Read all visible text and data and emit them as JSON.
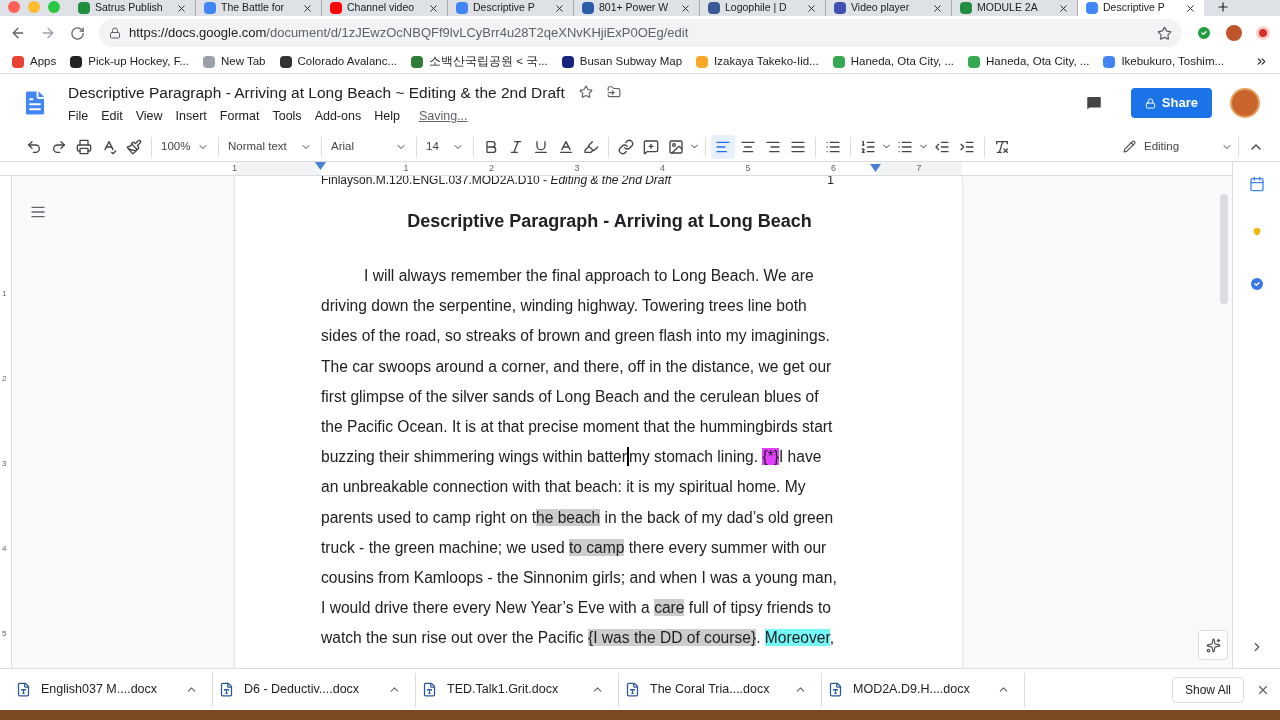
{
  "browser": {
    "tabs": [
      {
        "title": "Satrus Publish",
        "color": "#1e8e3e",
        "selected": false
      },
      {
        "title": "The Battle for",
        "color": "#4285f4",
        "selected": false
      },
      {
        "title": "Channel video",
        "color": "#ff0000",
        "selected": false
      },
      {
        "title": "Descriptive P",
        "color": "#4285f4",
        "selected": false
      },
      {
        "title": "801+ Power W",
        "color": "#2a5caa",
        "selected": false
      },
      {
        "title": "Logophile | D",
        "color": "#3b5998",
        "selected": false
      },
      {
        "title": "Video player",
        "color": "#3f51b5",
        "selected": false
      },
      {
        "title": "MODULE 2A",
        "color": "#1e8e3e",
        "selected": false
      },
      {
        "title": "Descriptive P",
        "color": "#4285f4",
        "selected": true
      }
    ],
    "url_host": "https://docs.google.com",
    "url_path": "/document/d/1zJEwzOcNBQFf9lvLCyBrr4u28T2qeXNvKHjiExP0OEg/edit",
    "bookmarks": [
      {
        "label": "Apps",
        "color": "#e94235"
      },
      {
        "label": "Pick-up Hockey, F...",
        "color": "#222222"
      },
      {
        "label": "New Tab",
        "color": "#9aa0a6"
      },
      {
        "label": "Colorado Avalanc...",
        "color": "#333333"
      },
      {
        "label": "소백산국립공원 < 국...",
        "color": "#2e7d32"
      },
      {
        "label": "Busan Subway Map",
        "color": "#1a237e"
      },
      {
        "label": "Izakaya Takeko-Iid...",
        "color": "#f9a825"
      },
      {
        "label": "Haneda, Ota City, ...",
        "color": "#34a853"
      },
      {
        "label": "Haneda, Ota City, ...",
        "color": "#34a853"
      },
      {
        "label": "Ikebukuro, Toshim...",
        "color": "#4285f4"
      }
    ]
  },
  "doc": {
    "title": "Descriptive Paragraph - Arriving at Long Beach ~ Editing & the 2nd Draft",
    "menus": [
      "File",
      "Edit",
      "View",
      "Insert",
      "Format",
      "Tools",
      "Add-ons",
      "Help"
    ],
    "save_status": "Saving...",
    "share": "Share"
  },
  "toolbar": {
    "zoom": "100%",
    "style": "Normal text",
    "font": "Arial",
    "size": "14",
    "mode": "Editing",
    "align": [
      {
        "kind": "left",
        "selected": true
      },
      {
        "kind": "center",
        "selected": false
      },
      {
        "kind": "right",
        "selected": false
      },
      {
        "kind": "justify",
        "selected": false
      }
    ]
  },
  "ruler_labels": [
    "1",
    "1",
    "2",
    "3",
    "4",
    "5",
    "6",
    "7"
  ],
  "vertical_ruler_labels": [
    "1",
    "2",
    "3",
    "4",
    "5"
  ],
  "page": {
    "header": "Finlayson.M.120.ENGL.037.MOD2A.D10 - *Editing & the 2nd Draft*",
    "page_number": "1",
    "heading": "Descriptive Paragraph - Arriving at Long Beach",
    "lines": [
      {
        "indent": true,
        "segments": [
          {
            "kind": "text",
            "text": "I will always remember the final approach to Long Beach. We are"
          }
        ]
      },
      {
        "indent": false,
        "segments": [
          {
            "kind": "text",
            "text": "driving down the serpentine, winding highway. Towering trees line both"
          }
        ]
      },
      {
        "indent": false,
        "segments": [
          {
            "kind": "text",
            "text": "sides of the road, so streaks of brown and green flash into my imaginings."
          }
        ]
      },
      {
        "indent": false,
        "segments": [
          {
            "kind": "text",
            "text": "The car swoops around a corner, and there, off in the distance, we get our"
          }
        ]
      },
      {
        "indent": false,
        "segments": [
          {
            "kind": "text",
            "text": "first glimpse of the silver sands of Long Beach and the cerulean blues of"
          }
        ]
      },
      {
        "indent": false,
        "segments": [
          {
            "kind": "text",
            "text": "the Pacific Ocean. It is at that precise moment that the hummingbirds start"
          }
        ]
      },
      {
        "indent": false,
        "segments": [
          {
            "kind": "text",
            "text": "buzzing their shimmering wings within batter"
          },
          {
            "kind": "caret"
          },
          {
            "kind": "text",
            "text": "my stomach lining. "
          },
          {
            "kind": "text",
            "text": "{*}",
            "color": "#e040fb"
          },
          {
            "kind": "text",
            "text": "I have"
          }
        ]
      },
      {
        "indent": false,
        "segments": [
          {
            "kind": "text",
            "text": "an unbreakable connection with that beach: it is my spiritual home. My"
          }
        ]
      },
      {
        "indent": false,
        "segments": [
          {
            "kind": "text",
            "text": "parents used to camp right on t"
          },
          {
            "kind": "text",
            "text": "he beach",
            "color": "#cccccc"
          },
          {
            "kind": "text",
            "text": " in the back of my dad’s old green"
          }
        ]
      },
      {
        "indent": false,
        "segments": [
          {
            "kind": "text",
            "text": "truck - the green machine; we used "
          },
          {
            "kind": "text",
            "text": "to camp",
            "color": "#cccccc"
          },
          {
            "kind": "text",
            "text": " there every summer with our"
          }
        ]
      },
      {
        "indent": false,
        "segments": [
          {
            "kind": "text",
            "text": "cousins from Kamloops - the Sinnonim girls; and when I was a young man,"
          }
        ]
      },
      {
        "indent": false,
        "segments": [
          {
            "kind": "text",
            "text": "I would drive there every New Year’s Eve with a "
          },
          {
            "kind": "text",
            "text": "care",
            "color": "#cccccc"
          },
          {
            "kind": "text",
            "text": " full of tipsy friends to"
          }
        ]
      },
      {
        "indent": false,
        "segments": [
          {
            "kind": "text",
            "text": "watch the sun rise out over the Pacific "
          },
          {
            "kind": "text",
            "text": "{I was the DD of course}",
            "color": "#cccccc",
            "after": ". "
          },
          {
            "kind": "text",
            "text": "Moreover",
            "color": "#73f7f7"
          },
          {
            "kind": "text",
            "text": ","
          }
        ]
      }
    ]
  },
  "downloads": {
    "files": [
      "English037 M....docx",
      "D6 - Deductiv....docx",
      "TED.Talk1.Grit.docx",
      "The Coral Tria....docx",
      "MOD2A.D9.H....docx"
    ],
    "show_all": "Show All"
  }
}
